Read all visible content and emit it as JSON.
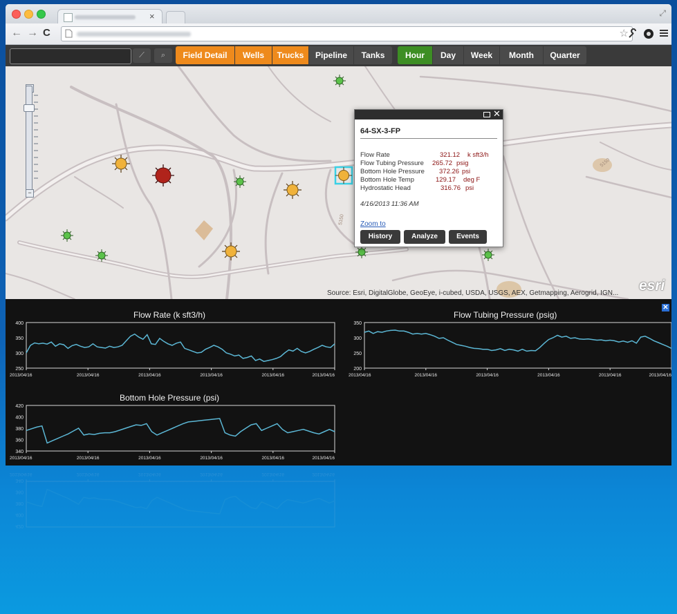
{
  "browser": {
    "tab_close": "×",
    "nav": {
      "back": "←",
      "forward": "→",
      "reload": "C"
    },
    "icons": [
      "page-icon",
      "star-icon",
      "wrench-icon",
      "extension-icon",
      "menu-icon"
    ]
  },
  "toolbar": {
    "search_value": "",
    "buttons": [
      "⟋",
      "⌕"
    ],
    "groups": {
      "layers": [
        "Field Detail",
        "Wells",
        "Trucks"
      ],
      "assets": [
        "Pipeline",
        "Tanks"
      ],
      "time": [
        "Hour",
        "Day",
        "Week",
        "Month",
        "Quarter"
      ]
    },
    "active_time": "Hour"
  },
  "map": {
    "road_label": "5150",
    "popup": {
      "title": "64-SX-3-FP",
      "rows": [
        {
          "label": "Flow Rate",
          "value": "321.12",
          "unit": "k sft3/h"
        },
        {
          "label": "Flow Tubing Pressure",
          "value": "265.72",
          "unit": "psig"
        },
        {
          "label": "Bottom Hole Pressure",
          "value": "372.26",
          "unit": "psi"
        },
        {
          "label": "Bottom Hole Temp",
          "value": "129.17",
          "unit": "deg F"
        },
        {
          "label": "Hydrostatic Head",
          "value": "316.76",
          "unit": "psi"
        }
      ],
      "timestamp": "4/16/2013 11:36 AM",
      "zoom_link": "Zoom to",
      "buttons": [
        "History",
        "Analyze",
        "Events"
      ]
    },
    "attribution": "Source: Esri, DigitalGlobe, GeoEye, i-cubed, USDA, USGS, AEX, Getmapping, Aerogrid, IGN...",
    "logo": "esri",
    "colors": {
      "alarm": "#b0231b",
      "warning": "#f0b23a",
      "ok": "#5cc24a",
      "selected": "#3ad1e6"
    }
  },
  "chart_data": [
    {
      "type": "line",
      "title": "Flow Rate (k sft3/h)",
      "ylim": [
        250,
        400
      ],
      "y_ticks": [
        250,
        300,
        350,
        400
      ],
      "x_tick_labels": [
        "2013/04/16",
        "2013/04/16",
        "2013/04/16",
        "2013/04/16",
        "2013/04/16",
        "2013/04/16"
      ],
      "series": [
        {
          "color": "#5cb8d6",
          "values": [
            300,
            325,
            333,
            330,
            332,
            329,
            336,
            322,
            330,
            327,
            315,
            324,
            328,
            322,
            318,
            320,
            330,
            320,
            318,
            316,
            322,
            318,
            320,
            325,
            340,
            355,
            362,
            352,
            345,
            360,
            330,
            328,
            348,
            338,
            330,
            325,
            332,
            336,
            315,
            310,
            305,
            300,
            302,
            312,
            318,
            325,
            320,
            312,
            300,
            296,
            290,
            293,
            282,
            285,
            290,
            275,
            280,
            272,
            275,
            278,
            282,
            288,
            300,
            310,
            306,
            315,
            305,
            300,
            305,
            312,
            318,
            325,
            320,
            318,
            330
          ]
        }
      ]
    },
    {
      "type": "line",
      "title": "Flow Tubing Pressure (psig)",
      "ylim": [
        200,
        350
      ],
      "y_ticks": [
        200,
        250,
        300,
        350
      ],
      "x_tick_labels": [
        "2013/04/16",
        "2013/04/16",
        "2013/04/16",
        "2013/04/16",
        "2013/04/16",
        "2013/04/16"
      ],
      "series": [
        {
          "color": "#5cb8d6",
          "values": [
            318,
            322,
            314,
            320,
            318,
            322,
            324,
            325,
            322,
            322,
            318,
            312,
            314,
            312,
            314,
            310,
            305,
            298,
            300,
            292,
            285,
            278,
            275,
            272,
            268,
            265,
            264,
            262,
            262,
            258,
            260,
            264,
            258,
            262,
            260,
            256,
            262,
            256,
            258,
            257,
            268,
            282,
            294,
            300,
            308,
            302,
            305,
            298,
            300,
            296,
            295,
            296,
            294,
            292,
            293,
            290,
            292,
            290,
            286,
            289,
            285,
            290,
            282,
            302,
            305,
            298,
            290,
            284,
            278,
            272,
            265
          ]
        }
      ]
    },
    {
      "type": "line",
      "title": "Bottom Hole Pressure (psi)",
      "ylim": [
        340,
        420
      ],
      "y_ticks": [
        340,
        360,
        380,
        400,
        420
      ],
      "x_tick_labels": [
        "2013/04/16",
        "2013/04/16",
        "2013/04/16",
        "2013/04/16",
        "2013/04/16",
        "2013/04/16"
      ],
      "series": [
        {
          "color": "#5cb8d6",
          "values": [
            376,
            379,
            382,
            384,
            354,
            358,
            362,
            366,
            370,
            375,
            380,
            368,
            370,
            369,
            371,
            372,
            372,
            374,
            377,
            380,
            383,
            386,
            385,
            388,
            374,
            368,
            372,
            376,
            380,
            384,
            388,
            391,
            392,
            393,
            394,
            395,
            396,
            397,
            372,
            368,
            366,
            374,
            380,
            386,
            388,
            376,
            380,
            384,
            388,
            378,
            372,
            374,
            376,
            378,
            375,
            372,
            370,
            374,
            378,
            374
          ]
        }
      ]
    }
  ]
}
